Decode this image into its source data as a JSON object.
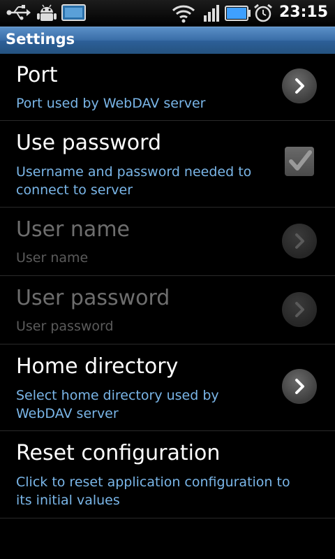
{
  "status_bar": {
    "time": "23:15",
    "left_icons": [
      "usb-icon",
      "android-debug-icon",
      "battery-indicator-icon"
    ],
    "right_icons": [
      "wifi-icon",
      "signal-icon",
      "battery-icon",
      "alarm-icon"
    ]
  },
  "title_bar": {
    "title": "Settings"
  },
  "preferences": [
    {
      "title": "Port",
      "summary": "Port used by WebDAV server",
      "widget": "chevron",
      "enabled": true
    },
    {
      "title": "Use password",
      "summary": "Username and password needed to connect to server",
      "widget": "checkbox",
      "checked": true,
      "enabled": true
    },
    {
      "title": "User name",
      "summary": "User name",
      "widget": "chevron",
      "enabled": false
    },
    {
      "title": "User password",
      "summary": "User password",
      "widget": "chevron",
      "enabled": false
    },
    {
      "title": "Home directory",
      "summary": "Select home directory used by WebDAV server",
      "widget": "chevron",
      "enabled": true
    },
    {
      "title": "Reset configuration",
      "summary": "Click to reset application configuration to its initial values",
      "widget": "none",
      "enabled": true
    }
  ],
  "colors": {
    "accent": "#7ab6e8",
    "title_bar": "#3a6ea8",
    "disabled_text": "#6e6e6e"
  }
}
